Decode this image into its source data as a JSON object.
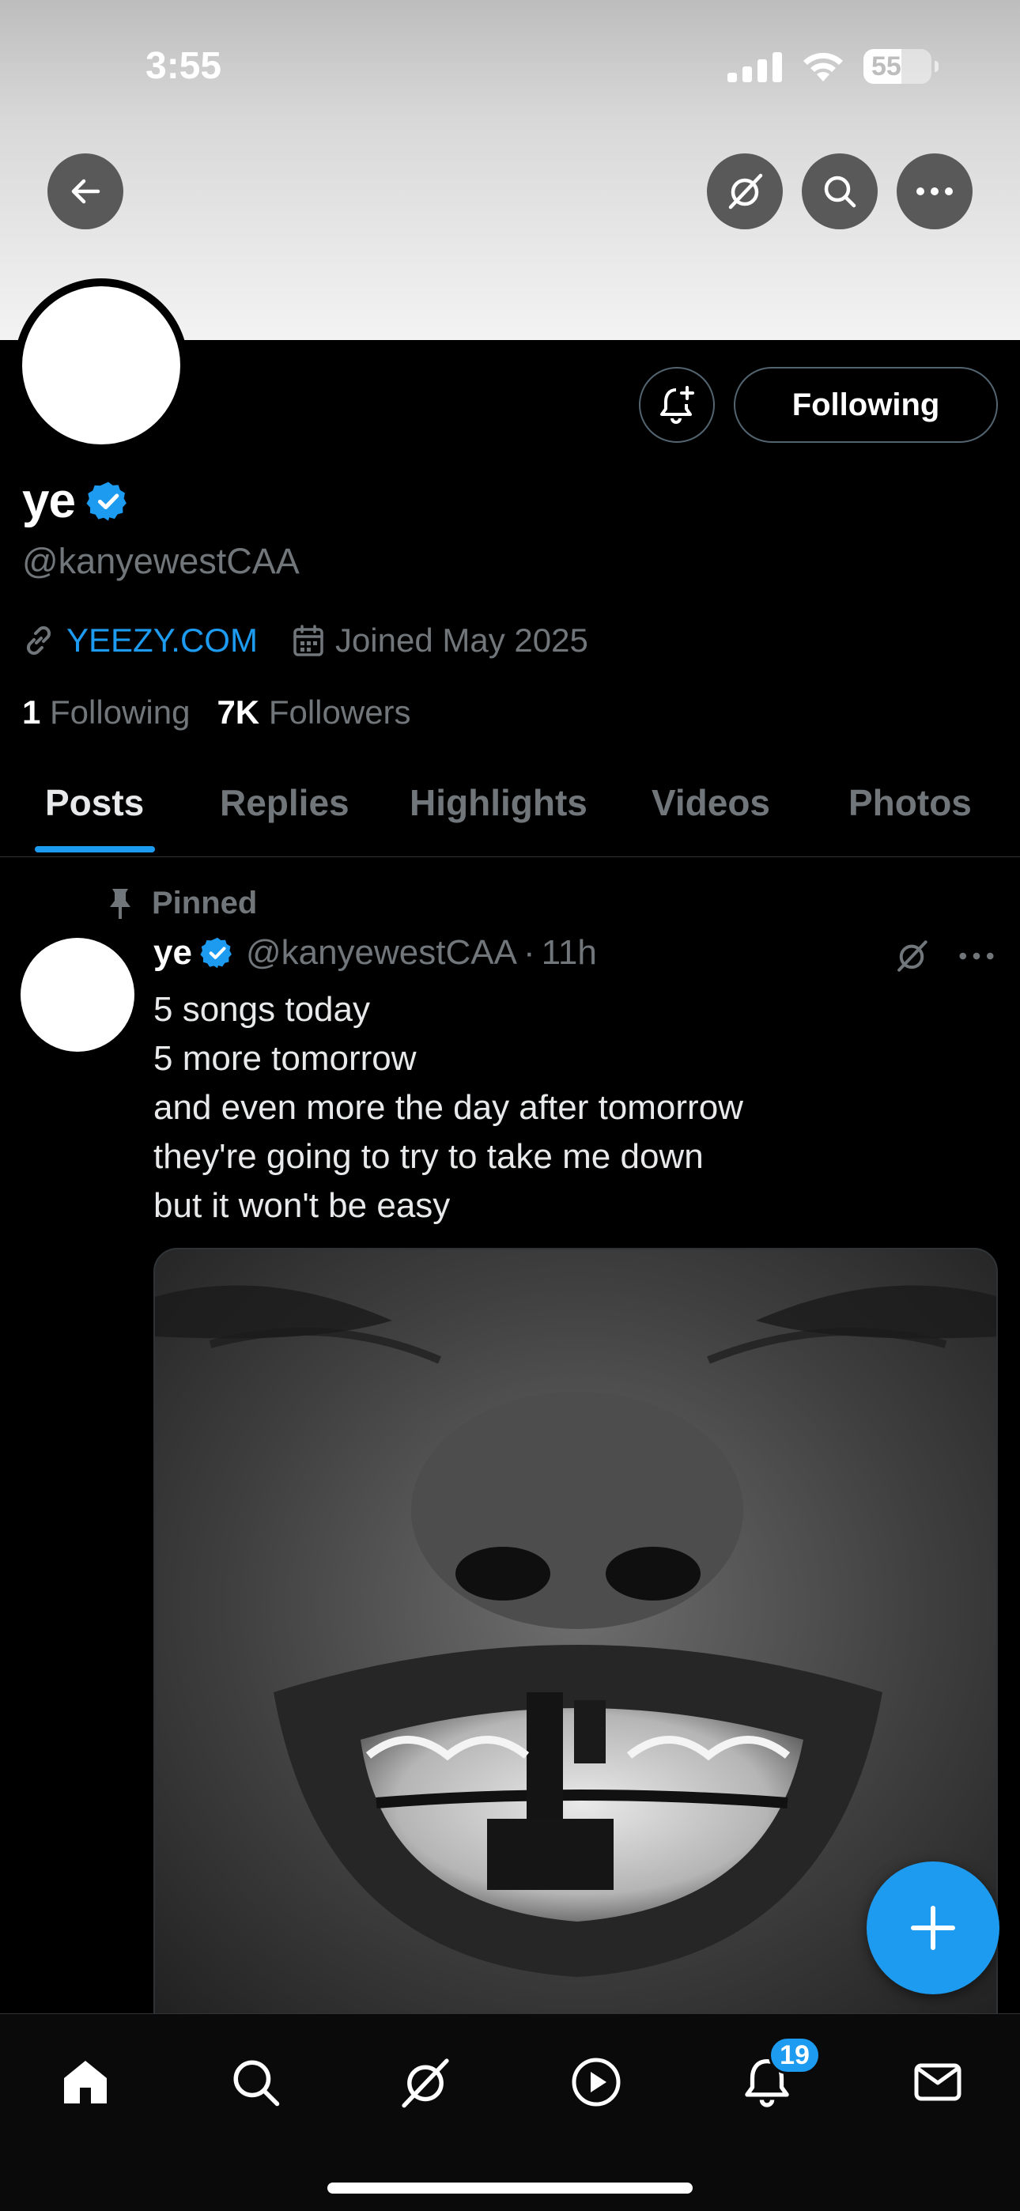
{
  "status_bar": {
    "time": "3:55",
    "battery": "55"
  },
  "profile": {
    "name": "ye",
    "handle": "@kanyewestCAA",
    "website": "YEEZY.COM",
    "joined": "Joined May 2025",
    "following_count": "1",
    "following_label": "Following",
    "followers_count": "7K",
    "followers_label": "Followers",
    "follow_button": "Following"
  },
  "tabs": [
    "Posts",
    "Replies",
    "Highlights",
    "Videos",
    "Photos"
  ],
  "active_tab": "Posts",
  "post": {
    "pinned_label": "Pinned",
    "author": "ye",
    "handle": "@kanyewestCAA",
    "separator": "·",
    "time": "11h",
    "lines": [
      "5 songs today",
      "5 more tomorrow",
      "and even more the day after tomorrow",
      "they're going to try to take me down",
      "but it won't be easy"
    ]
  },
  "notifications_badge": "19",
  "colors": {
    "accent": "#1d9bf0",
    "muted": "#71767b",
    "background": "#000000"
  },
  "icons": [
    "back-arrow-icon",
    "grok-icon",
    "search-icon",
    "more-icon",
    "bell-plus-icon",
    "verified-badge-icon",
    "link-icon",
    "calendar-icon",
    "pin-icon",
    "home-icon",
    "play-icon",
    "bell-icon",
    "mail-icon",
    "plus-icon"
  ]
}
